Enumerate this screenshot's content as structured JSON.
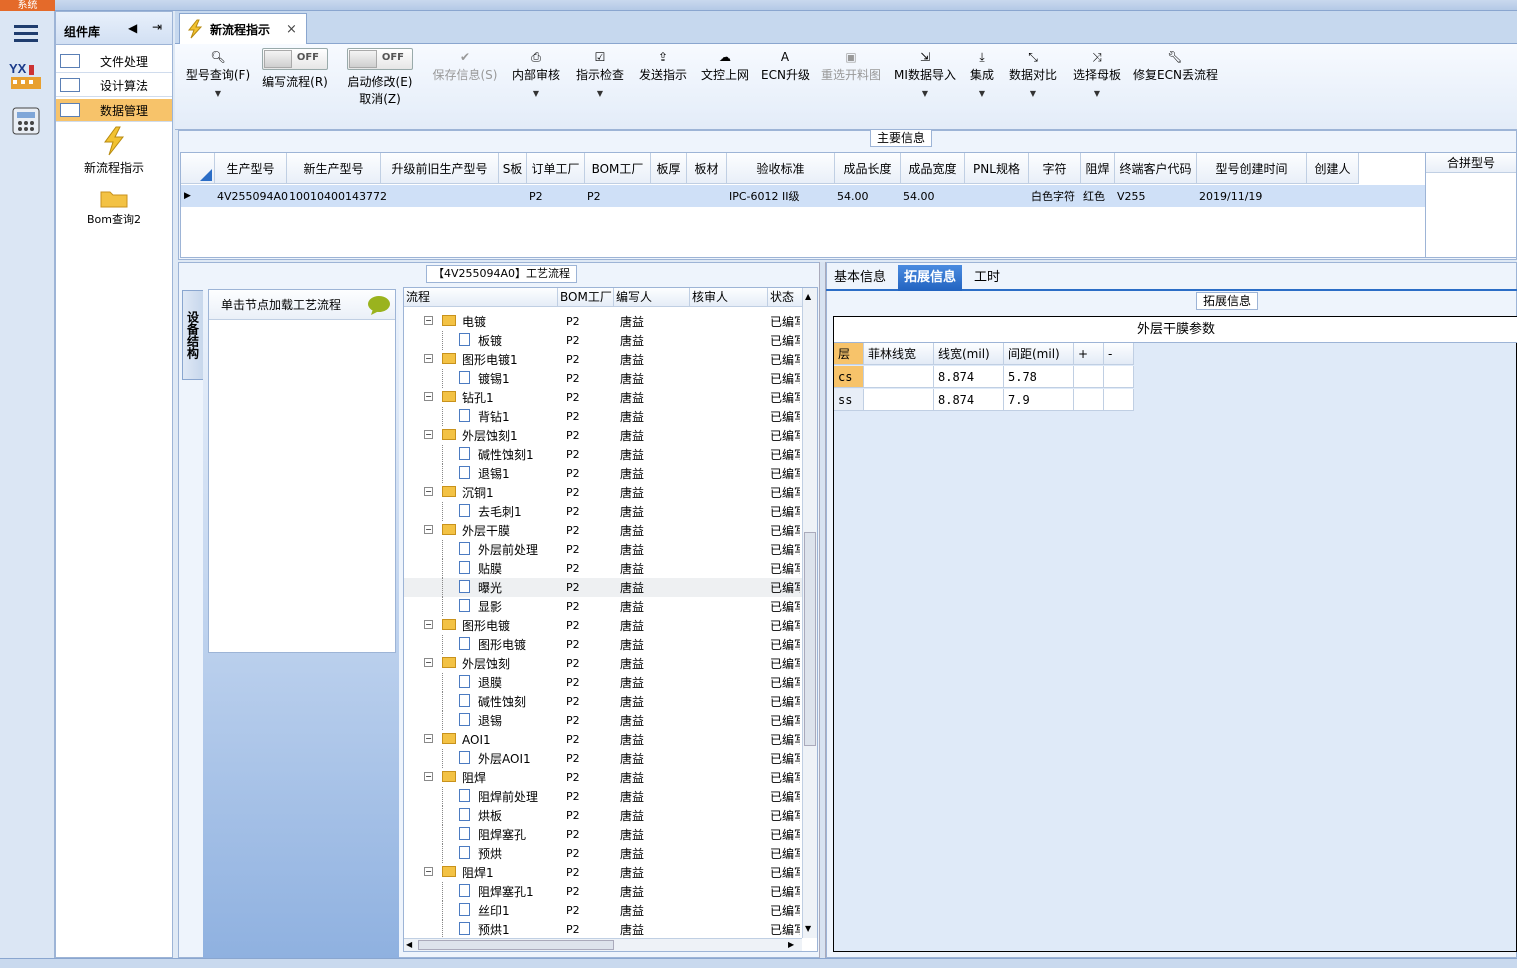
{
  "system_button": "系统",
  "component_panel": {
    "title": "组件库",
    "menu": [
      "文件处理",
      "设计算法",
      "数据管理"
    ],
    "tools": [
      "新流程指示",
      "Bom查询2"
    ]
  },
  "tab": {
    "label": "新流程指示",
    "close": "×"
  },
  "ribbon": {
    "model_query": "型号查询(F)",
    "toggle1_state": "OFF",
    "edit_flow": "编写流程(R)",
    "toggle2_state": "OFF",
    "start_modify": "启动修改(E)",
    "cancel": "取消(Z)",
    "save_info": "保存信息(S)",
    "internal_review": "内部审核",
    "indicate_check": "指示检查",
    "send_indicate": "发送指示",
    "doc_upload": "文控上网",
    "ecn_upgrade": "ECN升级",
    "reselect": "重选开料图",
    "mi_import": "MI数据导入",
    "integrate": "集成",
    "data_compare": "数据对比",
    "select_mother": "选择母板",
    "repair_ecn": "修复ECN丢流程"
  },
  "main_info": {
    "title": "主要信息",
    "columns": [
      "生产型号",
      "新生产型号",
      "升级前旧生产型号",
      "S板",
      "订单工厂",
      "BOM工厂",
      "板厚",
      "板材",
      "验收标准",
      "成品长度",
      "成品宽度",
      "PNL规格",
      "字符",
      "阻焊",
      "终端客户代码",
      "型号创建时间",
      "创建人"
    ],
    "row": [
      "4V255094A0",
      "10010400143772",
      "",
      "",
      "P2",
      "P2",
      "",
      "",
      "IPC-6012 II级",
      "54.00",
      "54.00",
      "",
      "白色字符",
      "红色",
      "V255",
      "2019/11/19",
      ""
    ],
    "merge_label": "合拼型号"
  },
  "flow_title": "【4V255094A0】工艺流程",
  "side_tab": "设备结构",
  "left_hint": "单击节点加载工艺流程",
  "tree": {
    "headers": [
      "流程",
      "BOM工厂",
      "编写人",
      "核审人",
      "状态"
    ],
    "rows": [
      {
        "name": "电镀",
        "type": "folder",
        "f": "P2",
        "w": "唐益",
        "s": "已编写"
      },
      {
        "name": "板镀",
        "type": "doc",
        "f": "P2",
        "w": "唐益",
        "s": "已编写"
      },
      {
        "name": "图形电镀1",
        "type": "folder",
        "f": "P2",
        "w": "唐益",
        "s": "已编写"
      },
      {
        "name": "镀锡1",
        "type": "doc",
        "f": "P2",
        "w": "唐益",
        "s": "已编写"
      },
      {
        "name": "钻孔1",
        "type": "folder",
        "f": "P2",
        "w": "唐益",
        "s": "已编写"
      },
      {
        "name": "背钻1",
        "type": "doc",
        "f": "P2",
        "w": "唐益",
        "s": "已编写"
      },
      {
        "name": "外层蚀刻1",
        "type": "folder",
        "f": "P2",
        "w": "唐益",
        "s": "已编写"
      },
      {
        "name": "碱性蚀刻1",
        "type": "doc",
        "f": "P2",
        "w": "唐益",
        "s": "已编写"
      },
      {
        "name": "退锡1",
        "type": "doc",
        "f": "P2",
        "w": "唐益",
        "s": "已编写"
      },
      {
        "name": "沉铜1",
        "type": "folder",
        "f": "P2",
        "w": "唐益",
        "s": "已编写"
      },
      {
        "name": "去毛刺1",
        "type": "doc",
        "f": "P2",
        "w": "唐益",
        "s": "已编写"
      },
      {
        "name": "外层干膜",
        "type": "folder",
        "f": "P2",
        "w": "唐益",
        "s": "已编写"
      },
      {
        "name": "外层前处理",
        "type": "doc",
        "f": "P2",
        "w": "唐益",
        "s": "已编写"
      },
      {
        "name": "贴膜",
        "type": "doc",
        "f": "P2",
        "w": "唐益",
        "s": "已编写"
      },
      {
        "name": "曝光",
        "type": "doc",
        "f": "P2",
        "w": "唐益",
        "s": "已编写"
      },
      {
        "name": "显影",
        "type": "doc",
        "f": "P2",
        "w": "唐益",
        "s": "已编写"
      },
      {
        "name": "图形电镀",
        "type": "folder",
        "f": "P2",
        "w": "唐益",
        "s": "已编写"
      },
      {
        "name": "图形电镀",
        "type": "doc",
        "f": "P2",
        "w": "唐益",
        "s": "已编写"
      },
      {
        "name": "外层蚀刻",
        "type": "folder",
        "f": "P2",
        "w": "唐益",
        "s": "已编写"
      },
      {
        "name": "退膜",
        "type": "doc",
        "f": "P2",
        "w": "唐益",
        "s": "已编写"
      },
      {
        "name": "碱性蚀刻",
        "type": "doc",
        "f": "P2",
        "w": "唐益",
        "s": "已编写"
      },
      {
        "name": "退锡",
        "type": "doc",
        "f": "P2",
        "w": "唐益",
        "s": "已编写"
      },
      {
        "name": "AOI1",
        "type": "folder",
        "f": "P2",
        "w": "唐益",
        "s": "已编写"
      },
      {
        "name": "外层AOI1",
        "type": "doc",
        "f": "P2",
        "w": "唐益",
        "s": "已编写"
      },
      {
        "name": "阻焊",
        "type": "folder",
        "f": "P2",
        "w": "唐益",
        "s": "已编写"
      },
      {
        "name": "阻焊前处理",
        "type": "doc",
        "f": "P2",
        "w": "唐益",
        "s": "已编写"
      },
      {
        "name": "烘板",
        "type": "doc",
        "f": "P2",
        "w": "唐益",
        "s": "已编写"
      },
      {
        "name": "阻焊塞孔",
        "type": "doc",
        "f": "P2",
        "w": "唐益",
        "s": "已编写"
      },
      {
        "name": "预烘",
        "type": "doc",
        "f": "P2",
        "w": "唐益",
        "s": "已编写"
      },
      {
        "name": "阻焊1",
        "type": "folder",
        "f": "P2",
        "w": "唐益",
        "s": "已编写"
      },
      {
        "name": "阻焊塞孔1",
        "type": "doc",
        "f": "P2",
        "w": "唐益",
        "s": "已编写"
      },
      {
        "name": "丝印1",
        "type": "doc",
        "f": "P2",
        "w": "唐益",
        "s": "已编写"
      },
      {
        "name": "预烘1",
        "type": "doc",
        "f": "P2",
        "w": "唐益",
        "s": "已编写"
      }
    ]
  },
  "right_tabs": [
    "基本信息",
    "拓展信息",
    "工时"
  ],
  "ext_title": "拓展信息",
  "param_table": {
    "title": "外层干膜参数",
    "headers": [
      "层",
      "菲林线宽",
      "线宽(mil)",
      "间距(mil)",
      "+",
      "-"
    ],
    "rows": [
      [
        "cs",
        "",
        "8.874",
        "5.78",
        "",
        ""
      ],
      [
        "ss",
        "",
        "8.874",
        "7.9",
        "",
        ""
      ]
    ]
  }
}
